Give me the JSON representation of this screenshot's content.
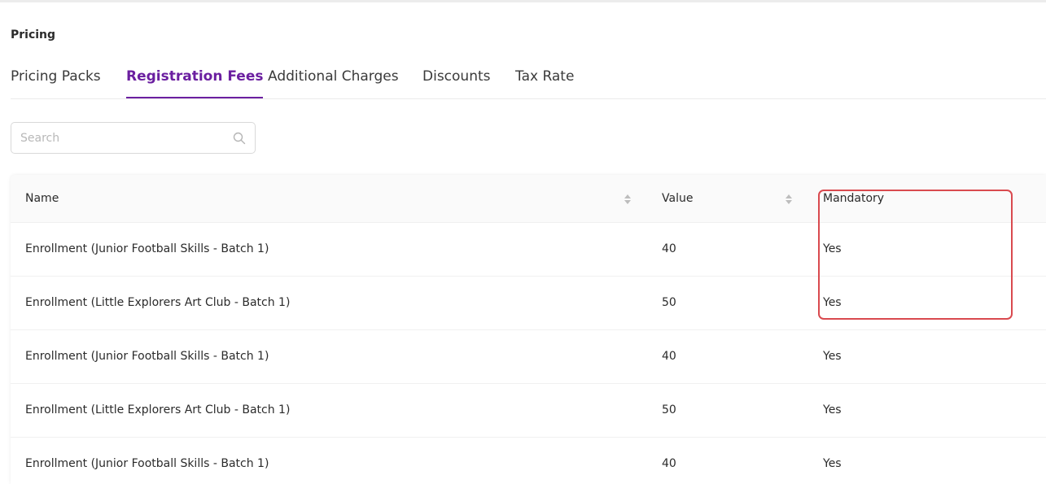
{
  "section": {
    "title": "Pricing"
  },
  "tabs": [
    {
      "label": "Pricing Packs",
      "active": false
    },
    {
      "label": "Registration Fees",
      "active": true
    },
    {
      "label": "Additional Charges",
      "active": false
    },
    {
      "label": "Discounts",
      "active": false
    },
    {
      "label": "Tax Rate",
      "active": false
    }
  ],
  "search": {
    "placeholder": "Search",
    "value": ""
  },
  "table": {
    "columns": {
      "name": "Name",
      "value": "Value",
      "mandatory": "Mandatory"
    },
    "rows": [
      {
        "name": "Enrollment (Junior Football Skills - Batch 1)",
        "value": "40",
        "mandatory": "Yes"
      },
      {
        "name": "Enrollment (Little Explorers Art Club - Batch 1)",
        "value": "50",
        "mandatory": "Yes"
      },
      {
        "name": "Enrollment (Junior Football Skills - Batch 1)",
        "value": "40",
        "mandatory": "Yes"
      },
      {
        "name": "Enrollment (Little Explorers Art Club - Batch 1)",
        "value": "50",
        "mandatory": "Yes"
      },
      {
        "name": "Enrollment (Junior Football Skills - Batch 1)",
        "value": "40",
        "mandatory": "Yes"
      }
    ]
  },
  "colors": {
    "accent": "#6b1fa0",
    "highlight": "#d94a4f"
  }
}
